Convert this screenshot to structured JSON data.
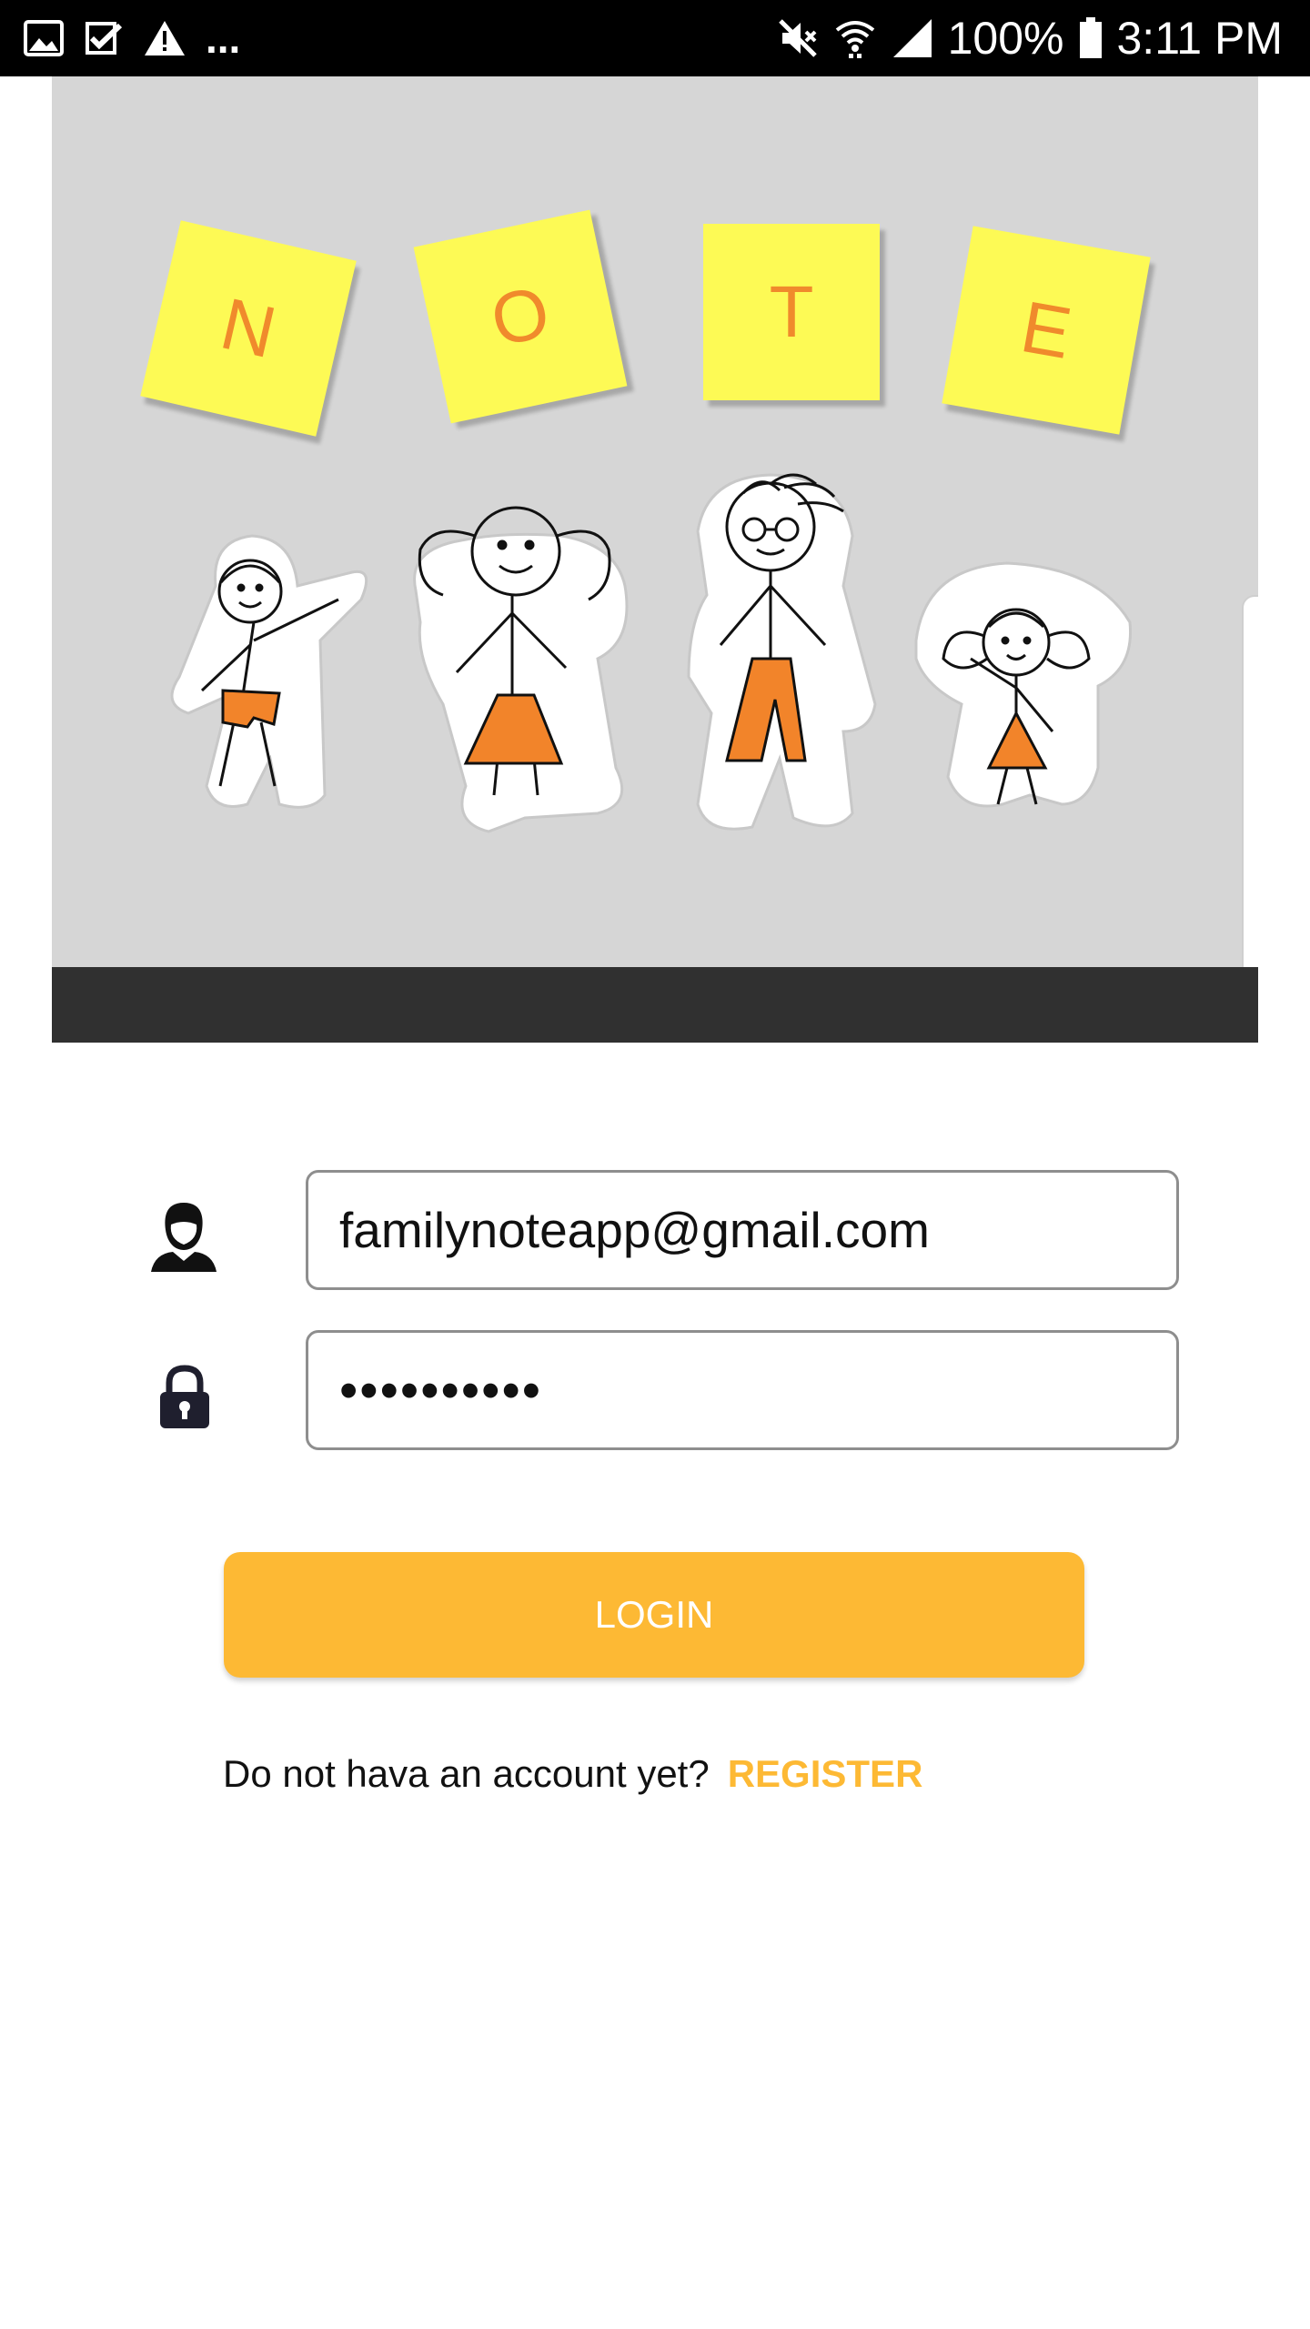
{
  "status_bar": {
    "battery": "100%",
    "time": "3:11 PM",
    "more": "...",
    "left_icons": [
      "image-icon",
      "check-icon",
      "warning-icon"
    ],
    "right_icons": [
      "mute-icon",
      "wifi-icon",
      "signal-icon",
      "battery-icon"
    ]
  },
  "hero": {
    "letters": [
      "N",
      "O",
      "T",
      "E"
    ],
    "colors": {
      "background": "#d6d6d6",
      "note": "#fdfa55",
      "letter": "#f08a2c",
      "bar": "#303030"
    }
  },
  "login_form": {
    "email_value": "familynoteapp@gmail.com",
    "password_value": "••••••••••",
    "login_label": "LOGIN",
    "register_prompt": "Do not hava an account yet?",
    "register_label": "REGISTER",
    "accent_color": "#fdb934"
  }
}
